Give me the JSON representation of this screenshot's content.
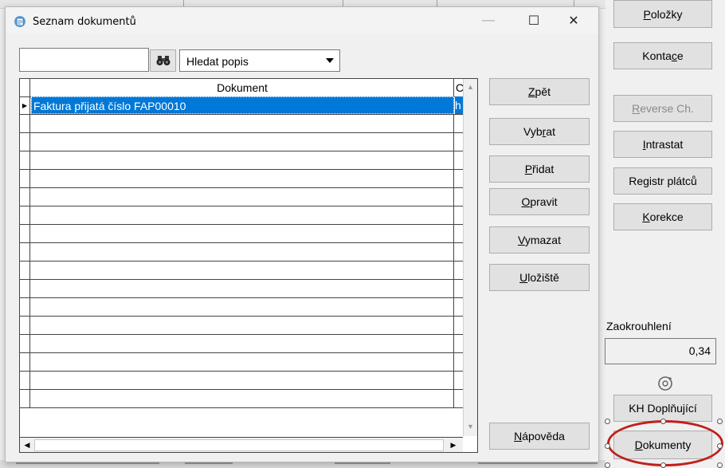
{
  "window": {
    "title": "Seznam dokumentů",
    "minimize_glyph": "—",
    "maximize_glyph": "☐",
    "close_glyph": "✕"
  },
  "search": {
    "input_value": "",
    "field_selected": "Hledat popis",
    "find_icon": "binoculars-icon"
  },
  "grid": {
    "columns": [
      "Dokument",
      "C"
    ],
    "rows": [
      {
        "dokument": "Faktura přijatá číslo FAP00010",
        "c": "h",
        "selected": true
      }
    ],
    "empty_rows": 16
  },
  "dialog_buttons": [
    {
      "pre": "",
      "key": "Z",
      "post": "pět"
    },
    {
      "pre": "Vyb",
      "key": "r",
      "post": "at"
    },
    {
      "pre": "",
      "key": "P",
      "post": "řidat"
    },
    {
      "pre": "",
      "key": "O",
      "post": "pravit"
    },
    {
      "pre": "",
      "key": "V",
      "post": "ymazat"
    },
    {
      "pre": "",
      "key": "U",
      "post": "ložiště"
    }
  ],
  "help_button": {
    "pre": "",
    "key": "N",
    "post": "ápověda"
  },
  "right_panel": {
    "buttons": [
      {
        "pre": "",
        "key": "P",
        "post": "oložky",
        "disabled": false
      },
      {
        "pre": "Konta",
        "key": "c",
        "post": "e",
        "disabled": false
      },
      {
        "pre": "",
        "key": "R",
        "post": "everse Ch.",
        "disabled": true
      },
      {
        "pre": "",
        "key": "I",
        "post": "ntrastat",
        "disabled": false
      },
      {
        "pre": "Registr plátců",
        "key": "",
        "post": "",
        "disabled": false
      },
      {
        "pre": "",
        "key": "K",
        "post": "orekce",
        "disabled": false
      }
    ],
    "rounding_label": "Zaokrouhlení",
    "rounding_value": "0,34",
    "kh_button": "KH Doplňující",
    "dokumenty_button": {
      "pre": "",
      "key": "D",
      "post": "okumenty"
    }
  },
  "colors": {
    "selection": "#0078d7",
    "highlight_ring": "#c0201b"
  }
}
